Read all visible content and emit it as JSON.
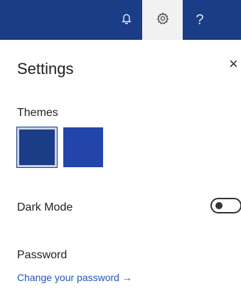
{
  "topbar": {
    "bell_icon": "bell-icon",
    "settings_icon": "gear-icon",
    "help_label": "?",
    "color": "#1b3c86"
  },
  "settings": {
    "title": "Settings",
    "close_label": "×",
    "themes_label": "Themes",
    "themes": [
      {
        "name": "navy",
        "color": "#1b3c86",
        "selected": true
      },
      {
        "name": "blue",
        "color": "#2345aa",
        "selected": false
      }
    ],
    "dark_mode_label": "Dark Mode",
    "dark_mode_on": false,
    "password_label": "Password",
    "change_password_link": "Change your password →"
  }
}
